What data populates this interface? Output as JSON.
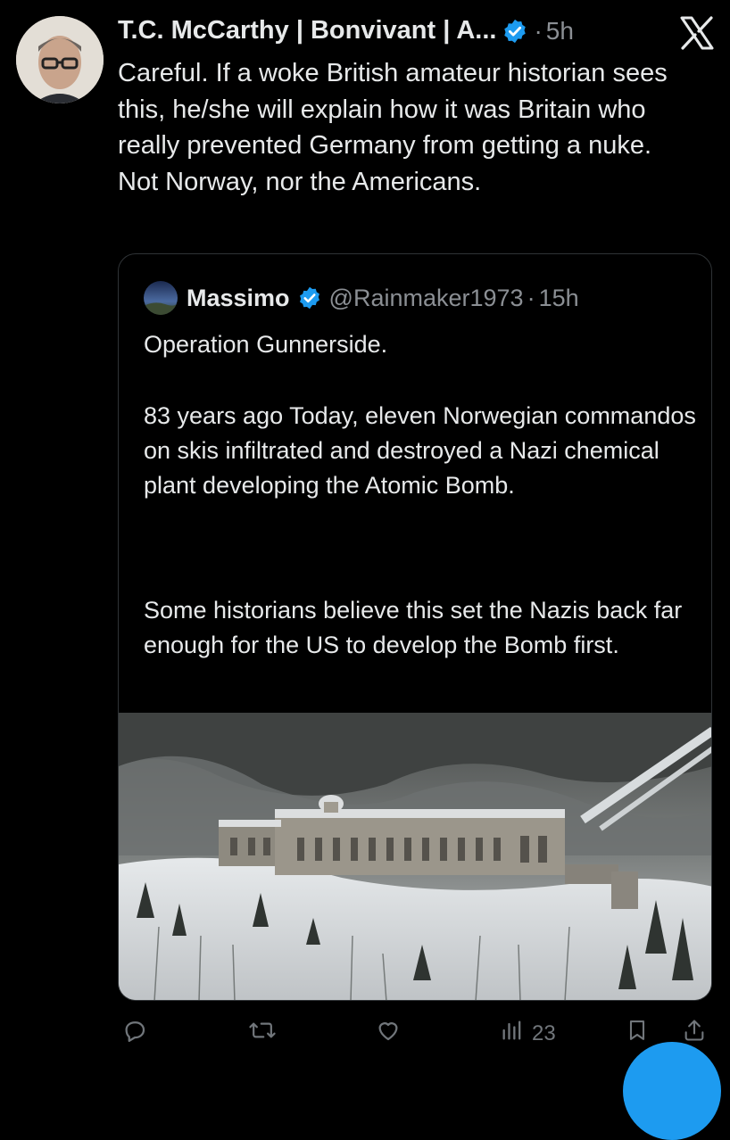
{
  "tweet": {
    "author_name": "T.C. McCarthy | Bonvivant | A...",
    "separator": "·",
    "time": "5h",
    "text": "Careful. If a woke British amateur historian sees this, he/she will explain how it was Britain who really prevented Germany from getting a nuke. Not Norway, nor the Americans."
  },
  "quote": {
    "name": "Massimo",
    "handle": "@Rainmaker1973",
    "separator": "·",
    "time": "15h",
    "paragraphs": [
      "Operation Gunnerside.",
      "83 years ago Today, eleven Norwegian commandos on skis infiltrated and destroyed a Nazi chemical plant developing the Atomic Bomb.",
      "Some historians believe this set the Nazis back far enough for the US to develop the Bomb first."
    ]
  },
  "actions": {
    "views": "23"
  },
  "colors": {
    "background": "#000000",
    "text": "#e7e9ea",
    "muted": "#8b8f94",
    "verified": "#1d9bf0",
    "border": "#2f3336"
  },
  "icons": [
    "x-logo-icon",
    "verified-badge-icon",
    "reply-icon",
    "retweet-icon",
    "like-icon",
    "views-icon",
    "bookmark-icon",
    "share-icon"
  ]
}
